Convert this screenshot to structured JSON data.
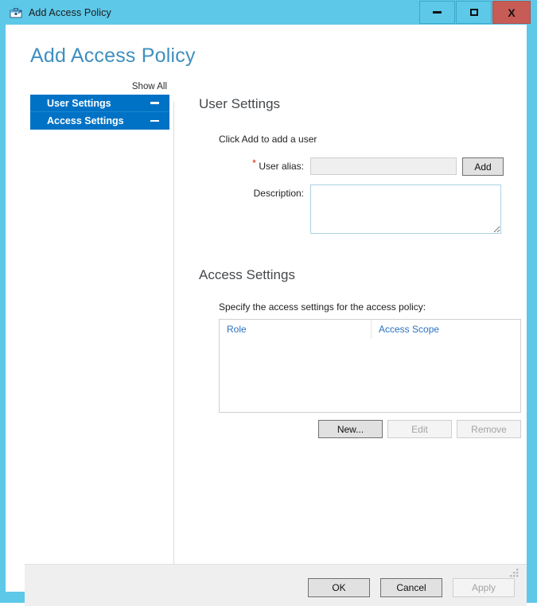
{
  "window": {
    "title": "Add Access Policy",
    "icon": "policy-toolbox-icon",
    "controls": {
      "minimize": "minimize-icon",
      "maximize": "maximize-icon",
      "close": "X"
    },
    "accent_color": "#5EC8E8",
    "close_color": "#C75B56"
  },
  "page": {
    "title": "Add Access Policy",
    "title_color": "#3E8FBF"
  },
  "sidebar": {
    "show_all_label": "Show All",
    "selected_color": "#0072C6",
    "items": [
      {
        "label": "User Settings",
        "collapse_icon": "minus-icon"
      },
      {
        "label": "Access Settings",
        "collapse_icon": "minus-icon"
      }
    ]
  },
  "user_settings": {
    "heading": "User Settings",
    "hint": "Click Add to add a user",
    "alias": {
      "required_marker": "*",
      "label": "User alias:",
      "value": "",
      "placeholder": "",
      "enabled": false
    },
    "description": {
      "label": "Description:",
      "value": "",
      "placeholder": ""
    },
    "add_button": "Add"
  },
  "access_settings": {
    "heading": "Access Settings",
    "hint": "Specify the access settings for the access policy:",
    "table": {
      "columns": [
        "Role",
        "Access Scope"
      ],
      "rows": []
    },
    "buttons": [
      {
        "label": "New...",
        "enabled": true
      },
      {
        "label": "Edit",
        "enabled": false
      },
      {
        "label": "Remove",
        "enabled": false
      }
    ]
  },
  "footer": {
    "buttons": [
      {
        "label": "OK",
        "enabled": true
      },
      {
        "label": "Cancel",
        "enabled": true
      },
      {
        "label": "Apply",
        "enabled": false
      }
    ],
    "resize_grip": "resize-grip-icon"
  }
}
